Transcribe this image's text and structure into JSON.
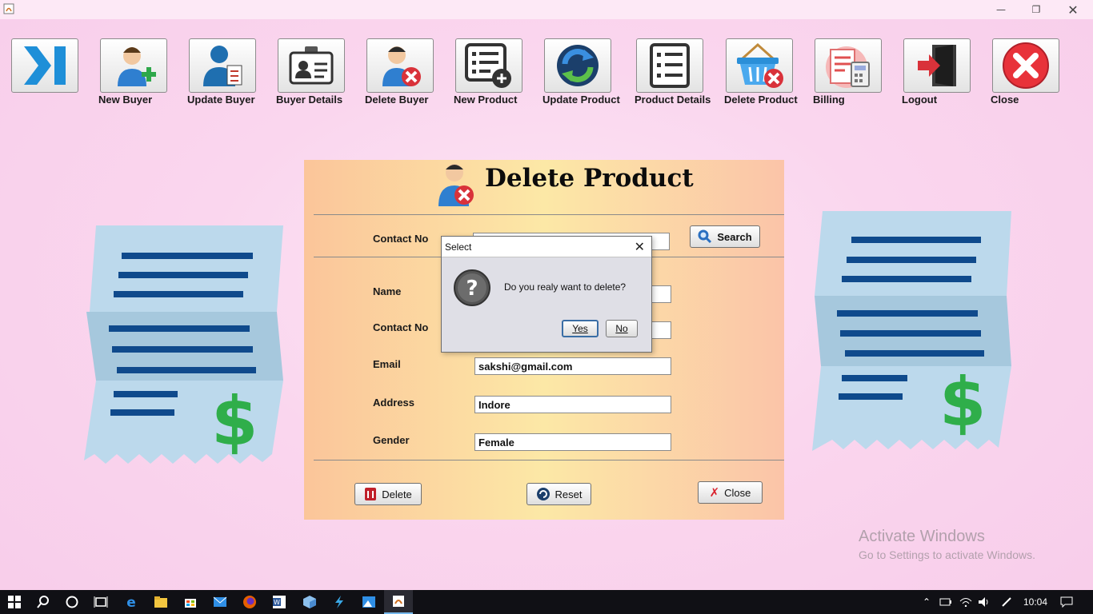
{
  "window": {
    "minimize_icon": "minimize-icon",
    "restore_icon": "restore-icon",
    "close_icon": "close-icon"
  },
  "toolbar": {
    "items": [
      {
        "label": "",
        "icon": "collapse-arrow-icon"
      },
      {
        "label": "New Buyer",
        "icon": "add-user-icon"
      },
      {
        "label": "Update Buyer",
        "icon": "edit-user-icon"
      },
      {
        "label": "Buyer Details",
        "icon": "id-card-icon"
      },
      {
        "label": "Delete Buyer",
        "icon": "remove-user-icon"
      },
      {
        "label": "New Product",
        "icon": "add-list-icon"
      },
      {
        "label": "Update Product",
        "icon": "refresh-icon"
      },
      {
        "label": "Product Details",
        "icon": "list-icon"
      },
      {
        "label": "Delete Product",
        "icon": "basket-remove-icon"
      },
      {
        "label": "Billing",
        "icon": "billing-icon"
      },
      {
        "label": "Logout",
        "icon": "logout-icon"
      },
      {
        "label": "Close",
        "icon": "close-circle-icon"
      }
    ]
  },
  "panel": {
    "title": "Delete Product",
    "search_label": "Contact No",
    "search_value": "",
    "search_button": "Search",
    "fields": {
      "name_label": "Name",
      "name_value": "",
      "contact_label": "Contact No",
      "contact_value": "",
      "email_label": "Email",
      "email_value": "sakshi@gmail.com",
      "address_label": "Address",
      "address_value": "Indore",
      "gender_label": "Gender",
      "gender_value": "Female"
    },
    "delete_button": "Delete",
    "reset_button": "Reset",
    "close_button": "Close"
  },
  "dialog": {
    "title": "Select",
    "message": "Do you realy want to delete?",
    "yes": "Yes",
    "no": "No"
  },
  "watermark": {
    "line1": "Activate Windows",
    "line2": "Go to Settings to activate Windows."
  },
  "taskbar": {
    "clock": "10:04"
  },
  "colors": {
    "background": "#f9d3ec",
    "panel_left": "#fbc59a",
    "panel_mid": "#fce8a6",
    "receipt": "#bcd9ec",
    "receipt_lines": "#0f4a8c",
    "dollar": "#2fae4a"
  }
}
